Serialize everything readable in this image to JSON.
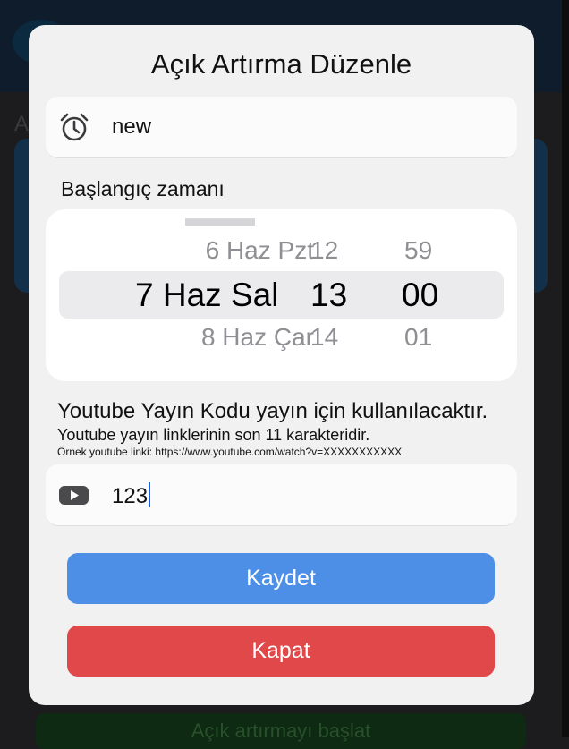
{
  "background": {
    "letter": "A",
    "bottom_button": "Açık artırmayı başlat"
  },
  "modal": {
    "title": "Açık Artırma Düzenle",
    "name_field": {
      "value": "new",
      "icon": "alarm-clock-icon"
    },
    "start_label": "Başlangıç zamanı",
    "picker": {
      "date": {
        "previous": "6 Haz Pzt",
        "selected": "7 Haz Sal",
        "next": "8 Haz Çar"
      },
      "hour": {
        "previous": "12",
        "selected": "13",
        "next": "14"
      },
      "minute": {
        "previous": "59",
        "selected": "00",
        "next": "01"
      }
    },
    "youtube_info": "Youtube Yayın Kodu yayın için kullanılacaktır.",
    "youtube_subinfo": "Youtube yayın linklerinin son 11 karakteridir.",
    "youtube_example": "Örnek youtube linki: https://www.youtube.com/watch?v=XXXXXXXXXXX",
    "youtube_field": {
      "value": "123",
      "icon": "youtube-play-icon"
    },
    "save_button": "Kaydet",
    "close_button": "Kapat"
  },
  "colors": {
    "save": "#4d8fe6",
    "close": "#e0484a",
    "caret": "#1463e6"
  }
}
